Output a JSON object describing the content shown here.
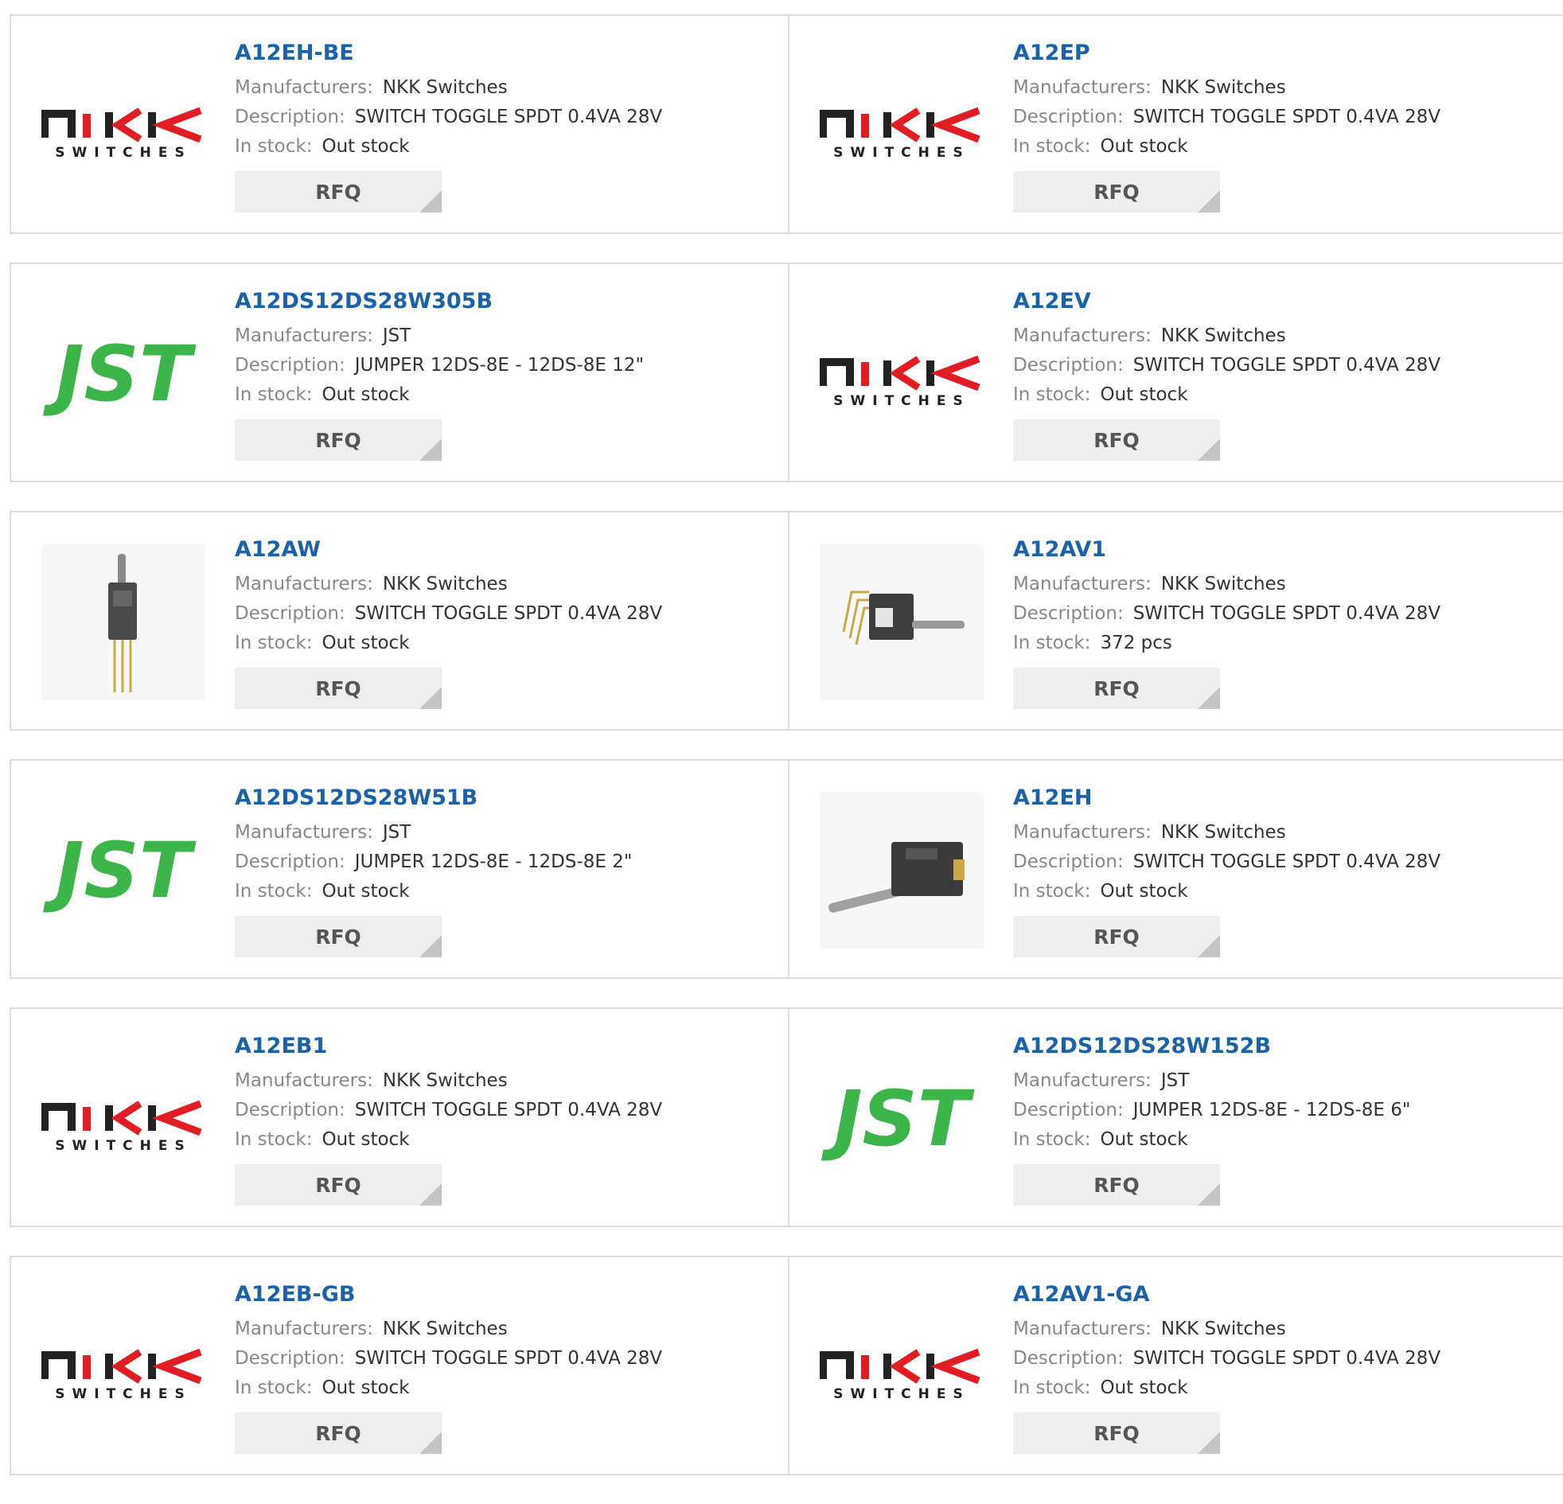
{
  "labels": {
    "manufacturers": "Manufacturers:",
    "description": "Description:",
    "stock": "In stock:",
    "rfq": "RFQ"
  },
  "logos": {
    "nkk_line1": "NKK",
    "nkk_line2": "SWITCHES",
    "jst": "JST"
  },
  "colors": {
    "link": "#1b62a8",
    "jst_green": "#3bb54a",
    "nkk_red": "#e31b23",
    "nkk_dark": "#222222"
  },
  "products": [
    {
      "part": "A12EH-BE",
      "manufacturer": "NKK Switches",
      "description": "SWITCH TOGGLE SPDT 0.4VA 28V",
      "stock": "Out stock",
      "image": "nkk-logo"
    },
    {
      "part": "A12EP",
      "manufacturer": "NKK Switches",
      "description": "SWITCH TOGGLE SPDT 0.4VA 28V",
      "stock": "Out stock",
      "image": "nkk-logo"
    },
    {
      "part": "A12DS12DS28W305B",
      "manufacturer": "JST",
      "description": "JUMPER 12DS-8E - 12DS-8E 12\"",
      "stock": "Out stock",
      "image": "jst-logo"
    },
    {
      "part": "A12EV",
      "manufacturer": "NKK Switches",
      "description": "SWITCH TOGGLE SPDT 0.4VA 28V",
      "stock": "Out stock",
      "image": "nkk-logo"
    },
    {
      "part": "A12AW",
      "manufacturer": "NKK Switches",
      "description": "SWITCH TOGGLE SPDT 0.4VA 28V",
      "stock": "Out stock",
      "image": "toggle-vertical-photo"
    },
    {
      "part": "A12AV1",
      "manufacturer": "NKK Switches",
      "description": "SWITCH TOGGLE SPDT 0.4VA 28V",
      "stock": "372 pcs",
      "image": "toggle-angled-photo"
    },
    {
      "part": "A12DS12DS28W51B",
      "manufacturer": "JST",
      "description": "JUMPER 12DS-8E - 12DS-8E 2\"",
      "stock": "Out stock",
      "image": "jst-logo"
    },
    {
      "part": "A12EH",
      "manufacturer": "NKK Switches",
      "description": "SWITCH TOGGLE SPDT 0.4VA 28V",
      "stock": "Out stock",
      "image": "toggle-horizontal-photo"
    },
    {
      "part": "A12EB1",
      "manufacturer": "NKK Switches",
      "description": "SWITCH TOGGLE SPDT 0.4VA 28V",
      "stock": "Out stock",
      "image": "nkk-logo"
    },
    {
      "part": "A12DS12DS28W152B",
      "manufacturer": "JST",
      "description": "JUMPER 12DS-8E - 12DS-8E 6\"",
      "stock": "Out stock",
      "image": "jst-logo"
    },
    {
      "part": "A12EB-GB",
      "manufacturer": "NKK Switches",
      "description": "SWITCH TOGGLE SPDT 0.4VA 28V",
      "stock": "Out stock",
      "image": "nkk-logo"
    },
    {
      "part": "A12AV1-GA",
      "manufacturer": "NKK Switches",
      "description": "SWITCH TOGGLE SPDT 0.4VA 28V",
      "stock": "Out stock",
      "image": "nkk-logo"
    }
  ]
}
